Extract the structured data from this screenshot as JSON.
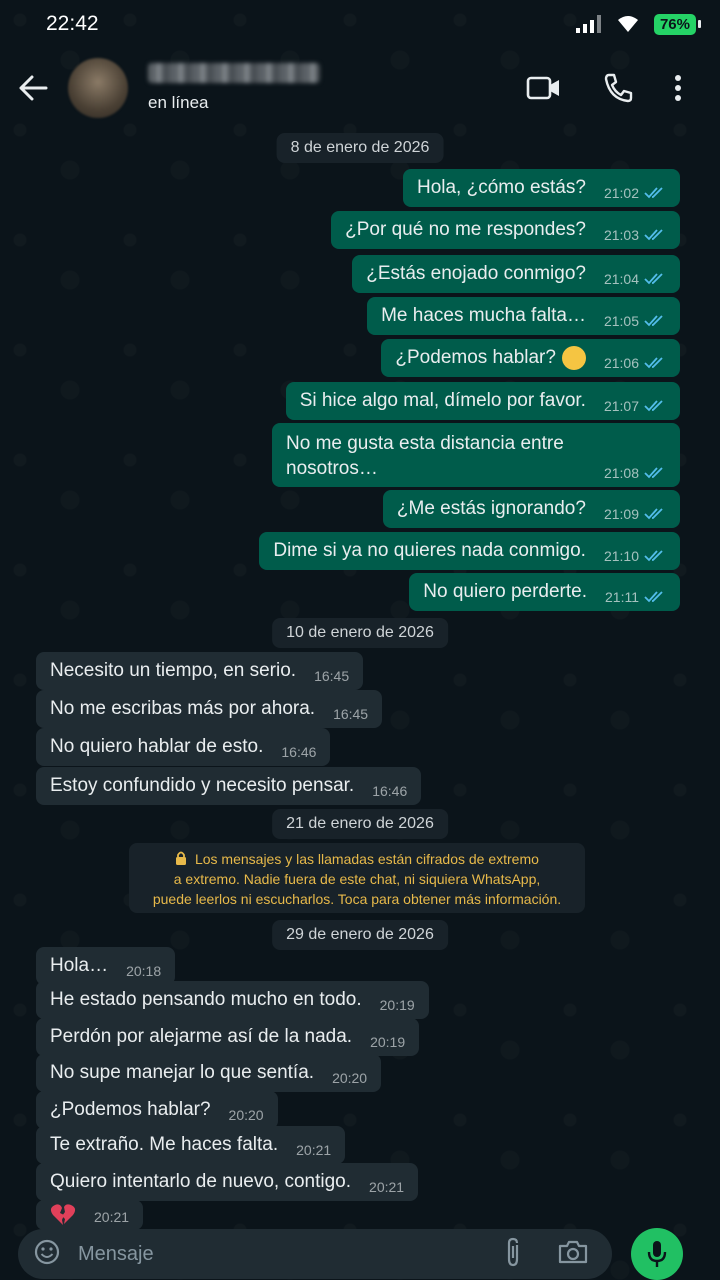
{
  "status_bar": {
    "time": "22:42",
    "battery": "76%"
  },
  "header": {
    "contact_status": "en línea"
  },
  "dates": {
    "d1": "8 de enero de 2026",
    "d2": "10 de enero de 2026",
    "d3": "21 de enero de 2026",
    "d4": "29 de enero de 2026"
  },
  "messages_out": [
    {
      "text": "Hola, ¿cómo estás?",
      "time": "21:02"
    },
    {
      "text": "¿Por qué no me respondes?",
      "time": "21:03"
    },
    {
      "text": "¿Estás enojado conmigo?",
      "time": "21:04"
    },
    {
      "text": "Me haces mucha falta…",
      "time": "21:05"
    },
    {
      "text": "¿Podemos hablar?",
      "time": "21:06"
    },
    {
      "text": "Si hice algo mal, dímelo por favor.",
      "time": "21:07"
    },
    {
      "text": "No me gusta esta distancia entre nosotros…",
      "time": "21:08"
    },
    {
      "text": "¿Me estás ignorando?",
      "time": "21:09"
    },
    {
      "text": "Dime si ya no quieres nada conmigo.",
      "time": "21:10"
    },
    {
      "text": "No quiero perderte.",
      "time": "21:11"
    }
  ],
  "messages_in_1": [
    {
      "text": "Necesito un tiempo, en serio.",
      "time": "16:45"
    },
    {
      "text": "No me escribas más por ahora.",
      "time": "16:45"
    },
    {
      "text": "No quiero hablar de esto.",
      "time": "16:46"
    },
    {
      "text": "Estoy confundido y necesito pensar.",
      "time": "16:46"
    }
  ],
  "encryption": {
    "line1": "Los mensajes y las llamadas están cifrados de extremo",
    "line2": "a extremo. Nadie fuera de este chat, ni siquiera WhatsApp,",
    "line3": "puede leerlos ni escucharlos. Toca para obtener más información."
  },
  "messages_in_2": [
    {
      "text": "Hola…",
      "time": "20:18"
    },
    {
      "text": "He estado pensando mucho en todo.",
      "time": "20:19"
    },
    {
      "text": "Perdón por alejarme así de la nada.",
      "time": "20:19"
    },
    {
      "text": "No supe manejar lo que sentía.",
      "time": "20:20"
    },
    {
      "text": "¿Podemos hablar?",
      "time": "20:20"
    },
    {
      "text": "Te extraño. Me haces falta.",
      "time": "20:21"
    },
    {
      "text": "Quiero intentarlo de nuevo, contigo.",
      "time": "20:21"
    },
    {
      "text": "",
      "time": "20:21",
      "icon": "broken-heart-emoji"
    }
  ],
  "input": {
    "placeholder": "Mensaje"
  },
  "colors": {
    "background": "#0b141a",
    "outgoing_bubble": "#005c4b",
    "incoming_bubble": "#202c33",
    "read_ticks": "#53bdeb",
    "accent": "#21c063",
    "encryption_text": "#e7b94a"
  }
}
